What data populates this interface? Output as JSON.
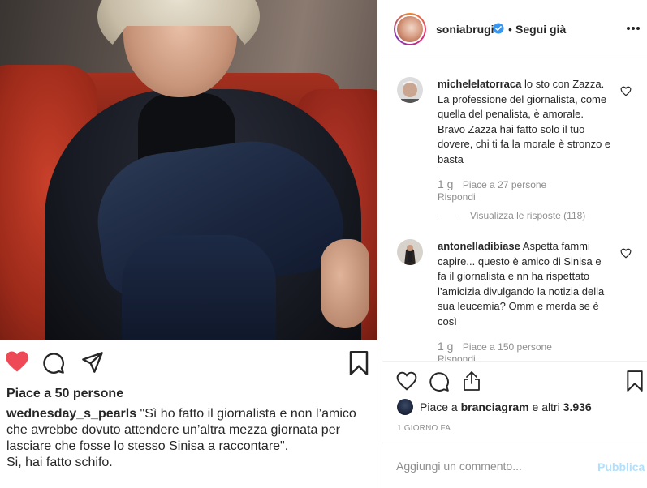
{
  "post": {
    "likes_text": "Piace a 50 persone",
    "caption_user": "wednesday_s_pearls",
    "caption_text": "\"Sì ho fatto il giornalista e non l’amico che avrebbe dovuto attendere un’altra mezza giornata per lasciare che fosse lo stesso Sinisa a raccontare\".",
    "caption_tail": "Si, hai fatto schifo."
  },
  "header": {
    "username": "soniabrugi",
    "separator": "•",
    "follow_label": "Segui già"
  },
  "comments": [
    {
      "user": "michelelatorraca",
      "text": "lo sto con Zazza. La professione del giornalista, come quella del penalista, è amorale. Bravo Zazza hai fatto solo il tuo dovere, chi ti fa la morale è stronzo e basta",
      "age": "1 g",
      "likes": "Piace a 27 persone",
      "reply": "Rispondi",
      "thread": "Visualizza le risposte (118)"
    },
    {
      "user": "antonelladibiase",
      "text": "Aspetta fammi capire... questo è amico di Sinisa e fa il giornalista e nn ha rispettato l’amicizia divulgando la notizia della sua leucemia? Omm e merda se è così",
      "age": "1 g",
      "likes": "Piace a 150 persone",
      "reply": "Rispondi"
    }
  ],
  "liked_by": {
    "prefix": "Piace a ",
    "user": "branciagram",
    "suffix": " e altri ",
    "count": "3.936"
  },
  "timestamp": "1 GIORNO FA",
  "add_comment": {
    "placeholder": "Aggiungi un commento...",
    "post_label": "Pubblica"
  },
  "colors": {
    "like_red": "#ed4956",
    "verified_blue": "#3897f0",
    "post_disabled": "#b2dffc",
    "muted_text": "#8e8e8e"
  }
}
